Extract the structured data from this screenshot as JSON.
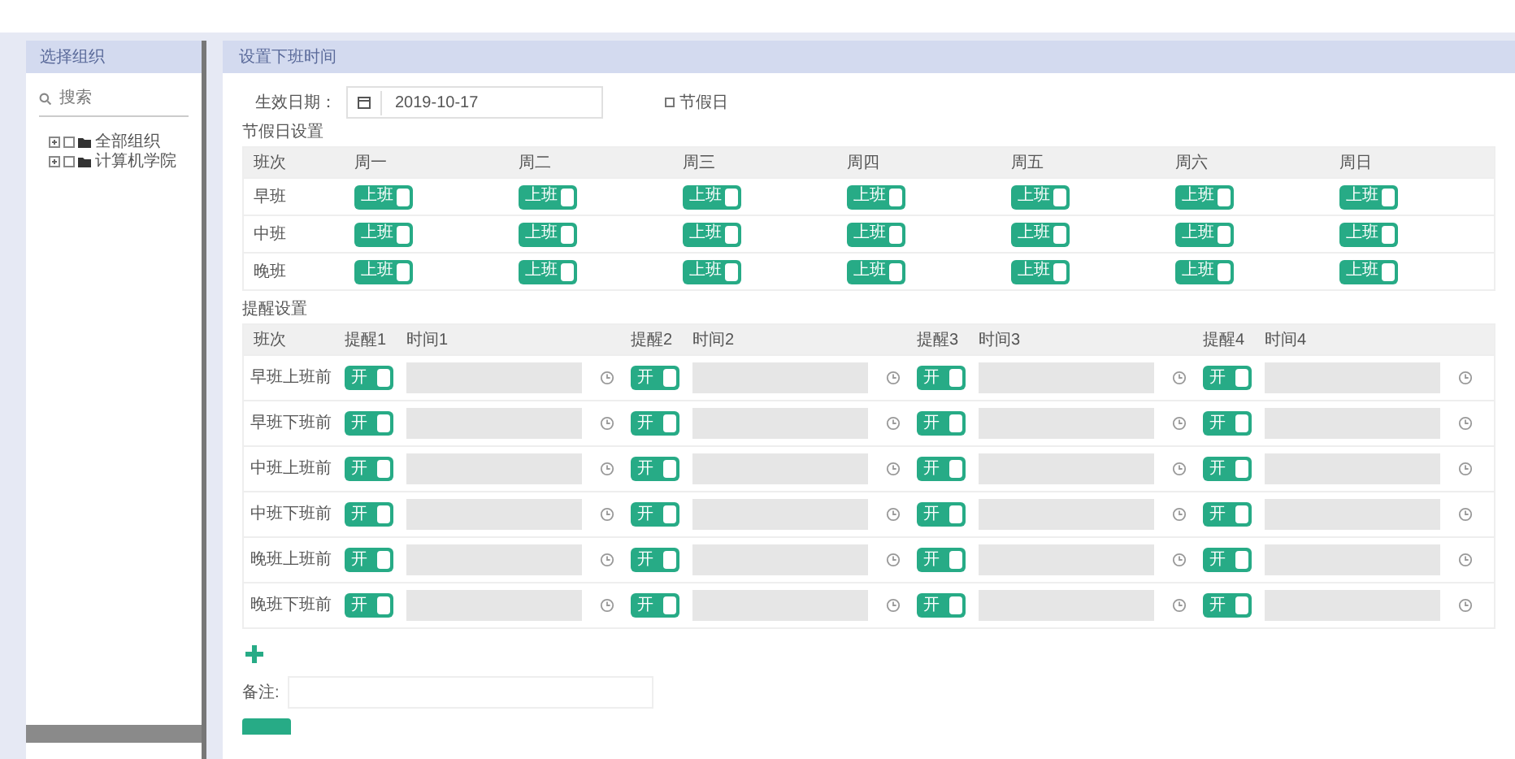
{
  "sidebar": {
    "title": "选择组织",
    "search": {
      "placeholder": "搜索"
    },
    "tree": [
      {
        "label": "全部组织",
        "expanded": false,
        "checked": false
      },
      {
        "label": "计算机学院",
        "expanded": false,
        "checked": false
      }
    ]
  },
  "main": {
    "title": "设置下班时间",
    "effective_date": {
      "label": "生效日期：",
      "value": "2019-10-17"
    },
    "holiday_option": {
      "label": "节假日",
      "checked": false
    },
    "shift_section": {
      "title": "节假日设置",
      "columns": [
        "班次",
        "周一",
        "周二",
        "周三",
        "周四",
        "周五",
        "周六",
        "周日"
      ],
      "rows": [
        {
          "name": "早班",
          "toggles": [
            {
              "label": "上班",
              "on": true
            },
            {
              "label": "上班",
              "on": true
            },
            {
              "label": "上班",
              "on": true
            },
            {
              "label": "上班",
              "on": true
            },
            {
              "label": "上班",
              "on": true
            },
            {
              "label": "上班",
              "on": true
            },
            {
              "label": "上班",
              "on": true
            }
          ]
        },
        {
          "name": "中班",
          "toggles": [
            {
              "label": "上班",
              "on": true
            },
            {
              "label": "上班",
              "on": true
            },
            {
              "label": "上班",
              "on": true
            },
            {
              "label": "上班",
              "on": true
            },
            {
              "label": "上班",
              "on": true
            },
            {
              "label": "上班",
              "on": true
            },
            {
              "label": "上班",
              "on": true
            }
          ]
        },
        {
          "name": "晚班",
          "toggles": [
            {
              "label": "上班",
              "on": true
            },
            {
              "label": "上班",
              "on": true
            },
            {
              "label": "上班",
              "on": true
            },
            {
              "label": "上班",
              "on": true
            },
            {
              "label": "上班",
              "on": true
            },
            {
              "label": "上班",
              "on": true
            },
            {
              "label": "上班",
              "on": true
            }
          ]
        }
      ]
    },
    "reminder_section": {
      "title": "提醒设置",
      "columns": [
        "班次",
        "提醒1",
        "时间1",
        "提醒2",
        "时间2",
        "提醒3",
        "时间3",
        "提醒4",
        "时间4"
      ],
      "rows": [
        {
          "name": "早班上班前",
          "toggles": [
            {
              "label": "开",
              "on": true
            },
            {
              "label": "开",
              "on": true
            },
            {
              "label": "开",
              "on": true
            },
            {
              "label": "开",
              "on": true
            }
          ]
        },
        {
          "name": "早班下班前",
          "toggles": [
            {
              "label": "开",
              "on": true
            },
            {
              "label": "开",
              "on": true
            },
            {
              "label": "开",
              "on": true
            },
            {
              "label": "开",
              "on": true
            }
          ]
        },
        {
          "name": "中班上班前",
          "toggles": [
            {
              "label": "开",
              "on": true
            },
            {
              "label": "开",
              "on": true
            },
            {
              "label": "开",
              "on": true
            },
            {
              "label": "开",
              "on": true
            }
          ]
        },
        {
          "name": "中班下班前",
          "toggles": [
            {
              "label": "开",
              "on": true
            },
            {
              "label": "开",
              "on": true
            },
            {
              "label": "开",
              "on": true
            },
            {
              "label": "开",
              "on": true
            }
          ]
        },
        {
          "name": "晚班上班前",
          "toggles": [
            {
              "label": "开",
              "on": true
            },
            {
              "label": "开",
              "on": true
            },
            {
              "label": "开",
              "on": true
            },
            {
              "label": "开",
              "on": true
            }
          ]
        },
        {
          "name": "晚班下班前",
          "toggles": [
            {
              "label": "开",
              "on": true
            },
            {
              "label": "开",
              "on": true
            },
            {
              "label": "开",
              "on": true
            },
            {
              "label": "开",
              "on": true
            }
          ]
        }
      ]
    },
    "remark": {
      "label": "备注:"
    }
  }
}
